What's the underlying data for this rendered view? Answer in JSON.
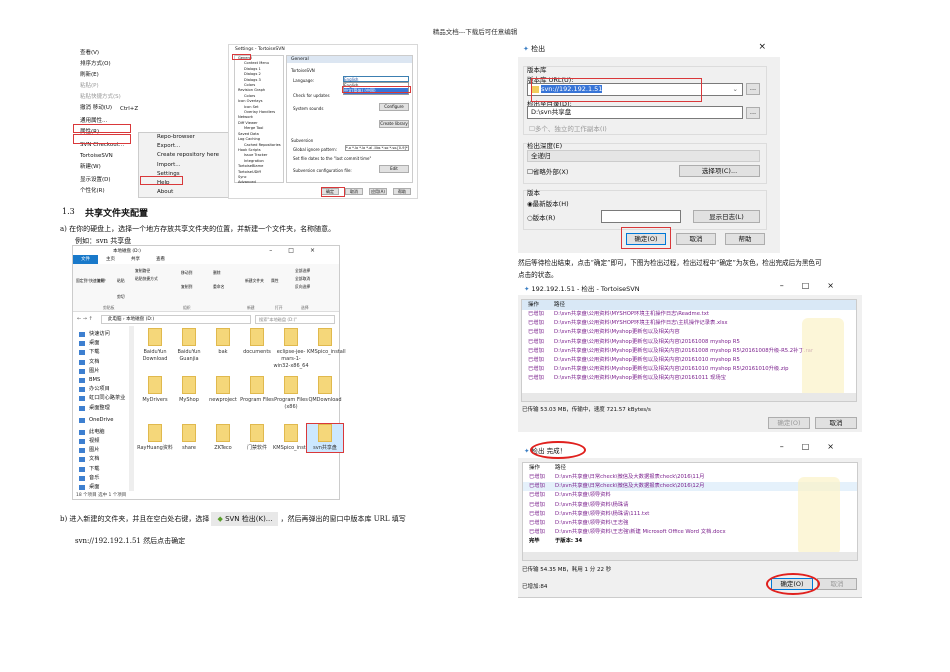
{
  "header": "精品文档---下载后可任意编辑",
  "context_menu": {
    "items": [
      "查看(V)",
      "排序方式(O)",
      "刷新(E)",
      "粘贴(P)",
      "粘贴快捷方式(S)",
      "撤消 移动(U)",
      "通用属性...",
      "属性(R)",
      "SVN Checkout...",
      "TortoiseSVN",
      "新建(W)",
      "显示设置(D)",
      "个性化(R)"
    ],
    "shortcut": "Ctrl+Z",
    "submenu": [
      "Repo-browser",
      "Export...",
      "Create repository here",
      "Import...",
      "Settings",
      "Help",
      "About"
    ]
  },
  "settings": {
    "title": "Settings - TortoiseSVN",
    "tree": [
      "General",
      "Context Menu",
      "Dialogs 1",
      "Dialogs 2",
      "Dialogs 3",
      "Colors",
      "Revision Graph",
      "Colors",
      "Icon Overlays",
      "Icon Set",
      "Overlay Handlers",
      "Network",
      "Diff Viewer",
      "Merge Tool",
      "Saved Data",
      "Log Caching",
      "Cached Repositories",
      "Hook Scripts",
      "Issue Tracker Integration",
      "TortoiseBlame",
      "TortoiseUDiff",
      "Sync",
      "Advanced"
    ],
    "panel_title": "General",
    "group1": "TortoiseSVN",
    "language_label": "Language:",
    "language_value": "English",
    "language_options": [
      "English",
      "中文(简体) (中国)"
    ],
    "updates_label": "Check for updates",
    "sounds_label": "System sounds",
    "configure": "Configure",
    "library": "Create library",
    "group2": "Subversion",
    "ignore_label": "Global ignore pattern:",
    "ignore_value": "*.o *.lo *.la *.al .libs *.so *.so.[0-9]* *.a *.pyc",
    "filedates": "Set file dates to the \"last commit time\"",
    "config_label": "Subversion configuration file:",
    "edit": "Edit",
    "buttons": [
      "确定",
      "取消",
      "应用(A)",
      "帮助"
    ]
  },
  "section": {
    "number": "1.3",
    "title": "共享文件夹配置"
  },
  "para_a": "a)  在你的硬盘上，选择一个地方存放共享文件夹的位置，并新建一个文件夹，名称随意。",
  "example": "例如：svn 共享盘",
  "explorer": {
    "title": "本地磁盘 (D:)",
    "tabs": [
      "文件",
      "主页",
      "共享",
      "查看"
    ],
    "ribbon_groups": [
      "剪贴板",
      "组织",
      "新建",
      "打开",
      "选择"
    ],
    "ribbon": [
      "固定到\"快速访问\"",
      "复制",
      "粘贴",
      "剪切",
      "复制路径",
      "粘贴快捷方式",
      "移动到",
      "删除",
      "复制到",
      "重命名",
      "新建文件夹",
      "属性",
      "全部选择",
      "全部取消",
      "反向选择"
    ],
    "path": [
      "此电脑",
      "本地磁盘 (D:)"
    ],
    "search_placeholder": "搜索\"本地磁盘 (D:)\"",
    "nav": [
      "快速访问",
      "桌面",
      "下载",
      "文档",
      "图片",
      "BMS",
      "办公项目",
      "虹口同心路茶业",
      "桌面整理",
      "OneDrive",
      "此电脑",
      "视频",
      "图片",
      "文档",
      "下载",
      "音乐",
      "桌面"
    ],
    "files": [
      "BaiduYun Download",
      "BaiduYun Guanjia",
      "bak",
      "documents",
      "eclipse-jee-mars-1-win32-x86_64",
      "KMSpico_install",
      "MyDrivers",
      "MyShop",
      "newproject",
      "Program Files",
      "Program Files (x86)",
      "QMDownload",
      "RayHuang资料",
      "share",
      "ZKTeco",
      "门禁软件",
      "KMSpico_install.zip",
      "svn共享盘"
    ],
    "status": "18 个项目    选中 1 个项目"
  },
  "para_b": {
    "before": "b)  进入新建的文件夹，并且在空白处右键，选择",
    "chip": "SVN 检出(K)...",
    "after": "，然后再弹出的窗口中版本库 URL 填写",
    "line2": "svn://192.192.1.51  然后点击确定"
  },
  "checkout": {
    "title": "检出",
    "repo_group": "版本库",
    "url_label": "版本库 URL(U):",
    "url": "svn://192.192.1.51",
    "dir_label": "检出至目录(D):",
    "dir": "D:\\svn共享盘",
    "multi": "多个、独立的工作副本(I)",
    "depth_group": "检出深度(E)",
    "depth": "全递归",
    "omit": "省略外部(X)",
    "choose": "选择项(C)...",
    "rev_group": "版本",
    "head": "最新版本(H)",
    "revision": "版本(R)",
    "showlog": "显示日志(L)",
    "ok": "确定(O)",
    "cancel": "取消",
    "help": "帮助"
  },
  "para_c": [
    "然后等待检出结束，点击“确定”即可，下图为检出过程，检出过程中“确定”为灰色，检出完成后为黑色可",
    "点击的状态。"
  ],
  "progress": {
    "title": "192.192.1.51 - 检出 - TortoiseSVN",
    "col_op": "操作",
    "col_path": "路径",
    "rows": [
      [
        "已增加",
        "D:\\svn共享盘\\公用资料\\MYSHOP环境主机操作日志\\Readme.txt"
      ],
      [
        "已增加",
        "D:\\svn共享盘\\公用资料\\MYSHOP环境主机操作日志\\主机操作记录表.xlsx"
      ],
      [
        "已增加",
        "D:\\svn共享盘\\公用资料\\Myshop更新包以及相关内容"
      ],
      [
        "已增加",
        "D:\\svn共享盘\\公用资料\\Myshop更新包以及相关内容\\20161008 myshop R5"
      ],
      [
        "已增加",
        "D:\\svn共享盘\\公用资料\\Myshop更新包以及相关内容\\20161008 myshop R5\\20161008升级-R5.2补丁.rar"
      ],
      [
        "已增加",
        "D:\\svn共享盘\\公用资料\\Myshop更新包以及相关内容\\20161010 myshop R5"
      ],
      [
        "已增加",
        "D:\\svn共享盘\\公用资料\\Myshop更新包以及相关内容\\20161010 myshop R5\\20161010升级.zip"
      ],
      [
        "已增加",
        "D:\\svn共享盘\\公用资料\\Myshop更新包以及相关内容\\20161011 现场宝"
      ]
    ],
    "status": "已传输 53.03 MB，传输中，速度 721.57 kBytes/s",
    "ok": "确定(O)",
    "cancel": "取消"
  },
  "complete": {
    "title": "检出 完成！",
    "col_op": "操作",
    "col_path": "路径",
    "rows": [
      [
        "已增加",
        "D:\\svn共享盘\\日常check\\微信及大数据报表check\\2016\\11月"
      ],
      [
        "已增加",
        "D:\\svn共享盘\\日常check\\微信及大数据报表check\\2016\\12月"
      ],
      [
        "已增加",
        "D:\\svn共享盘\\领导资料"
      ],
      [
        "已增加",
        "D:\\svn共享盘\\领导资料\\杨珠请"
      ],
      [
        "已增加",
        "D:\\svn共享盘\\领导资料\\杨珠请\\111.txt"
      ],
      [
        "已增加",
        "D:\\svn共享盘\\领导资料\\王志強"
      ],
      [
        "已增加",
        "D:\\svn共享盘\\领导资料\\王志強\\新建 Microsoft Office Word 文档.docx"
      ],
      [
        "完毕",
        "于版本: 34"
      ]
    ],
    "status": "已传输 54.35 MB，耗用 1 分 22 秒",
    "added": "已增加:84",
    "ok": "确定(O)",
    "cancel": "取消"
  }
}
